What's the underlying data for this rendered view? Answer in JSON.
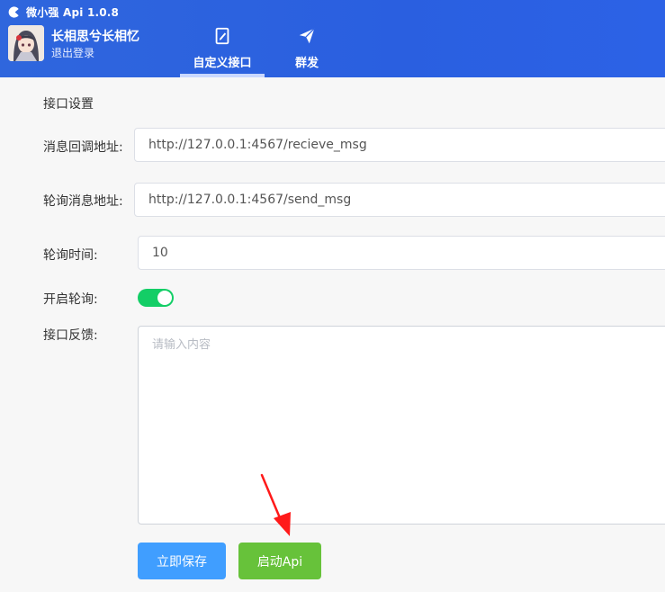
{
  "app": {
    "title": "微小强 Api 1.0.8"
  },
  "user": {
    "name": "长相思兮长相忆",
    "logout_label": "退出登录"
  },
  "tabs": [
    {
      "label": "自定义接口",
      "icon": "notebook-pen-icon",
      "active": true
    },
    {
      "label": "群发",
      "icon": "paper-plane-icon",
      "active": false
    }
  ],
  "form": {
    "section_title": "接口设置",
    "callback_label": "消息回调地址:",
    "callback_value": "http://127.0.0.1:4567/recieve_msg",
    "poll_addr_label": "轮询消息地址:",
    "poll_addr_value": "http://127.0.0.1:4567/send_msg",
    "poll_interval_label": "轮询时间:",
    "poll_interval_value": "10",
    "poll_enable_label": "开启轮询:",
    "poll_enabled": true,
    "feedback_label": "接口反馈:",
    "feedback_placeholder": "请输入内容"
  },
  "buttons": {
    "save_label": "立即保存",
    "start_label": "启动Api"
  },
  "colors": {
    "header": "#2c62e2",
    "primary_button": "#409eff",
    "success_button": "#67c23a",
    "switch_on": "#13ce66",
    "annotation_arrow": "#ff0000"
  }
}
